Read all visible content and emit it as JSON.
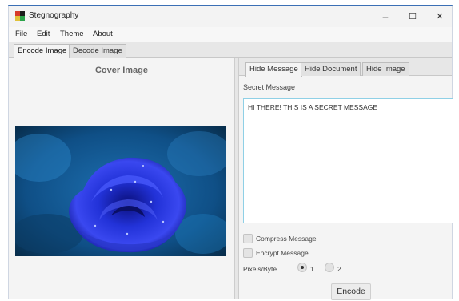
{
  "window": {
    "title": "Stegnography",
    "controls": {
      "minimize": "–",
      "maximize": "☐",
      "close": "✕"
    }
  },
  "menu": {
    "items": [
      "File",
      "Edit",
      "Theme",
      "About"
    ]
  },
  "main_tabs": [
    {
      "label": "Encode Image",
      "active": true
    },
    {
      "label": "Decode Image",
      "active": false
    }
  ],
  "left": {
    "cover_title": "Cover Image",
    "image_subject": "blue rose with water droplets"
  },
  "right": {
    "tabs": [
      {
        "label": "Hide Message",
        "active": true
      },
      {
        "label": "Hide Document",
        "active": false
      },
      {
        "label": "Hide Image",
        "active": false
      }
    ],
    "secret_label": "Secret Message",
    "secret_value": "HI THERE! THIS IS A SECRET MESSAGE",
    "compress_label": "Compress Message",
    "encrypt_label": "Encrypt Message",
    "pixels_label": "Pixels/Byte",
    "pixel_options": [
      "1",
      "2"
    ],
    "pixel_selected": "1",
    "encode_label": "Encode"
  },
  "colors": {
    "title_accent": "#3b6fb5",
    "textarea_focus": "#8fd0e6",
    "rose": "#1f2fd6"
  }
}
